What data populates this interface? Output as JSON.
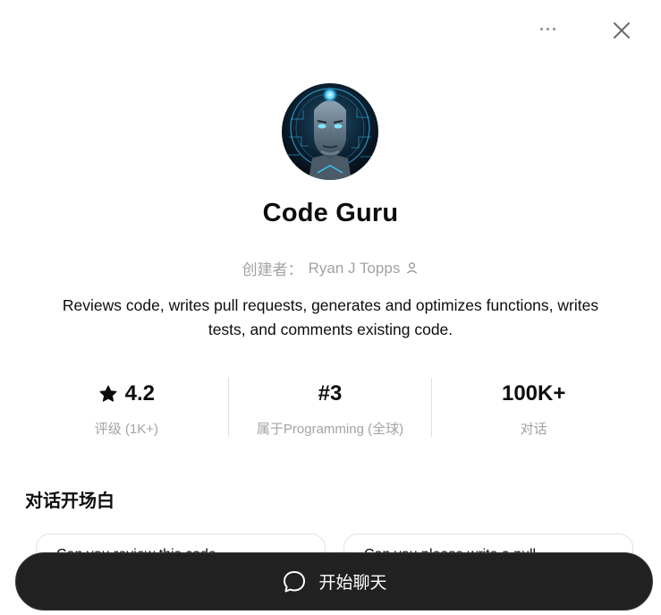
{
  "header": {
    "more_icon": "ellipsis-icon",
    "close_icon": "close-icon"
  },
  "gpt": {
    "name": "Code Guru",
    "creator_prefix": "创建者：",
    "creator_name": "Ryan J Topps",
    "description": "Reviews code, writes pull requests, generates and optimizes functions, writes tests, and comments existing code.",
    "avatar": "robot-avatar"
  },
  "stats": [
    {
      "value": "4.2",
      "label": "评级 (1K+)",
      "icon": "star-icon"
    },
    {
      "value": "#3",
      "label": "属于Programming (全球)"
    },
    {
      "value": "100K+",
      "label": "对话"
    }
  ],
  "conversation_starters": {
    "title": "对话开场白",
    "items": [
      "Can you review this code...",
      "Can you please write a pull..."
    ]
  },
  "chat_button": {
    "label": "开始聊天",
    "icon": "chat-bubble-icon"
  },
  "colors": {
    "button_bg": "#212121",
    "muted_text": "#a3a3a3",
    "text": "#0d0d0d"
  }
}
